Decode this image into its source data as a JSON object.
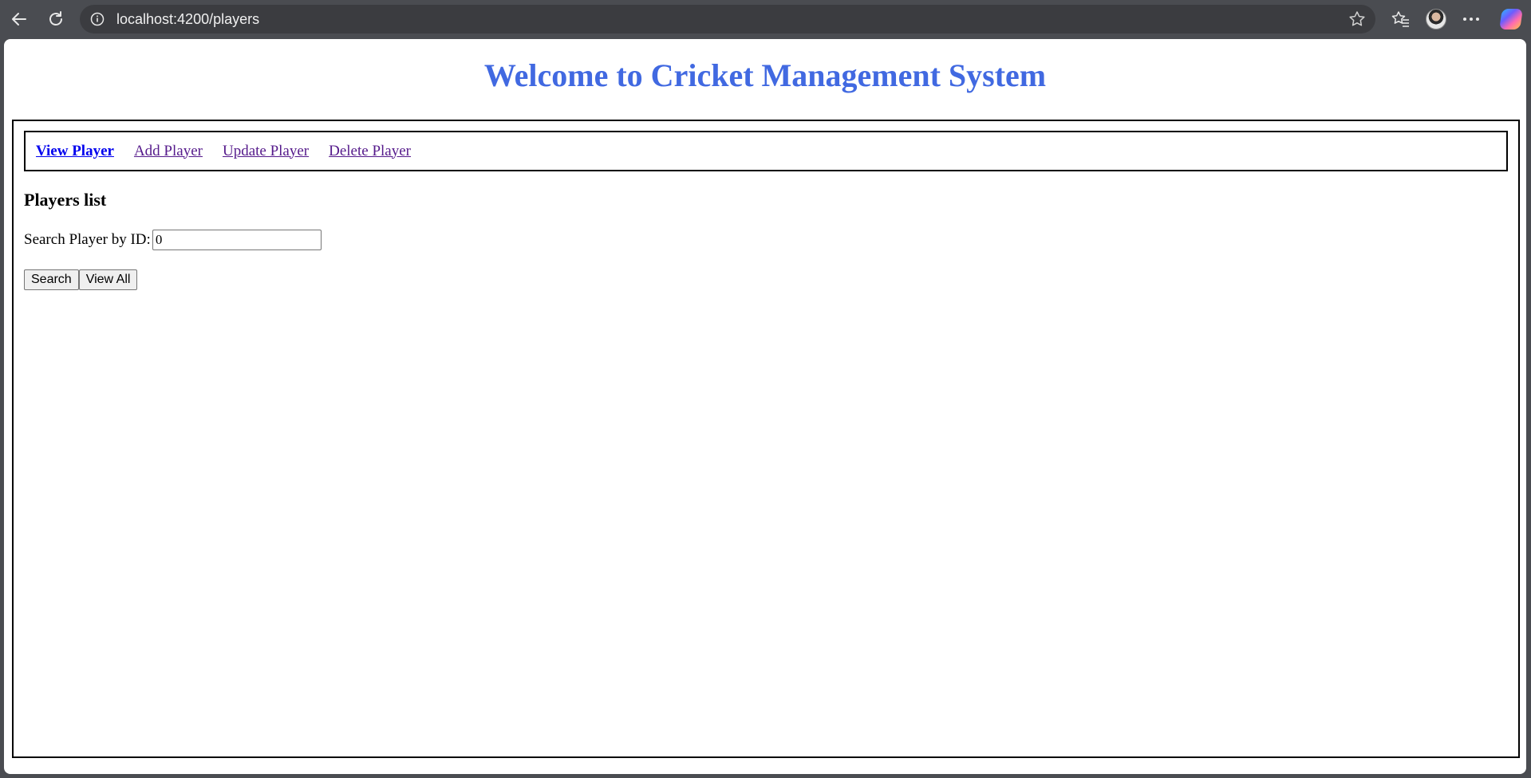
{
  "browser": {
    "url": "localhost:4200/players"
  },
  "page": {
    "title": "Welcome to Cricket Management System",
    "nav": [
      {
        "label": "View Player",
        "active": true
      },
      {
        "label": "Add Player",
        "active": false
      },
      {
        "label": "Update Player",
        "active": false
      },
      {
        "label": "Delete Player",
        "active": false
      }
    ],
    "section_title": "Players list",
    "search": {
      "label": "Search Player by ID:",
      "value": "0"
    },
    "buttons": {
      "search_label": "Search",
      "view_all_label": "View All"
    }
  },
  "colors": {
    "title": "#4169e1",
    "link_active": "#0000ee",
    "link_visited": "#551a8b",
    "chrome_bg": "#4a4c51"
  }
}
